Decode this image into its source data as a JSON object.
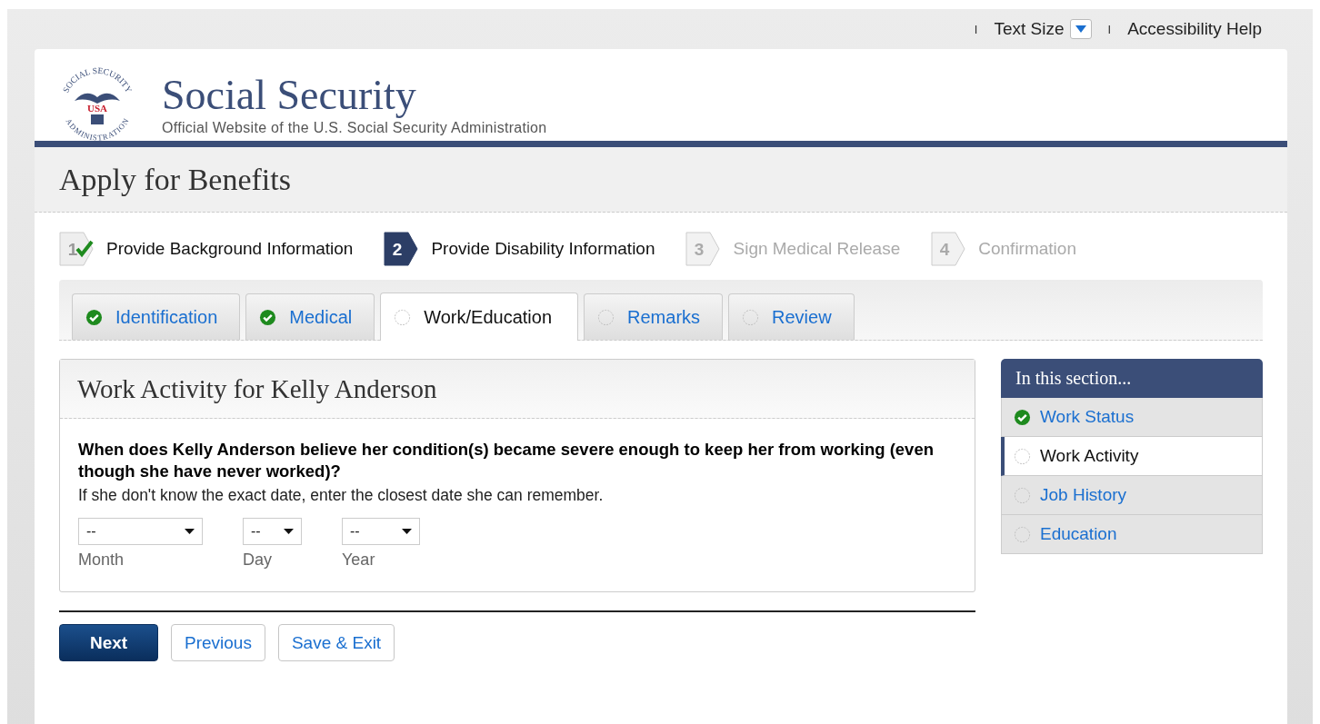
{
  "top_links": {
    "text_size": "Text Size",
    "accessibility": "Accessibility Help",
    "separators": [
      "I",
      "I"
    ]
  },
  "header": {
    "logo": {
      "top": "SOCIAL SECURITY",
      "middle": "USA",
      "bottom": "ADMINISTRATION"
    },
    "title": "Social Security",
    "subtitle": "Official Website of the U.S. Social Security Administration"
  },
  "page_title": "Apply for Benefits",
  "steps": [
    {
      "number": "1",
      "label": "Provide Background Information",
      "kind": "completed"
    },
    {
      "number": "2",
      "label": "Provide Disability Information",
      "kind": "current"
    },
    {
      "number": "3",
      "label": "Sign Medical Release",
      "kind": "upcoming"
    },
    {
      "number": "4",
      "label": "Confirmation",
      "kind": "upcoming"
    }
  ],
  "tabs": [
    {
      "label": "Identification",
      "complete": true,
      "selected": false
    },
    {
      "label": "Medical",
      "complete": true,
      "selected": false
    },
    {
      "label": "Work/Education",
      "complete": false,
      "selected": true
    },
    {
      "label": "Remarks",
      "complete": false,
      "selected": false
    },
    {
      "label": "Review",
      "complete": false,
      "selected": false
    }
  ],
  "form": {
    "title": "Work Activity for Kelly Anderson",
    "question": "When does Kelly Anderson believe her condition(s) became severe enough to keep her from working (even though she have never worked)?",
    "hint": "If she don't know the exact date, enter the closest date she can remember.",
    "fields": [
      {
        "value": "--",
        "label": "Month"
      },
      {
        "value": "--",
        "label": "Day"
      },
      {
        "value": "--",
        "label": "Year"
      }
    ]
  },
  "buttons": [
    {
      "label": "Next",
      "kind": "primary"
    },
    {
      "label": "Previous",
      "kind": "secondary"
    },
    {
      "label": "Save & Exit",
      "kind": "secondary"
    }
  ],
  "sidebar": {
    "title": "In this section...",
    "items": [
      {
        "label": "Work Status",
        "complete": true,
        "selected": false
      },
      {
        "label": "Work Activity",
        "complete": false,
        "selected": true
      },
      {
        "label": "Job History",
        "complete": false,
        "selected": false
      },
      {
        "label": "Education",
        "complete": false,
        "selected": false
      }
    ]
  }
}
